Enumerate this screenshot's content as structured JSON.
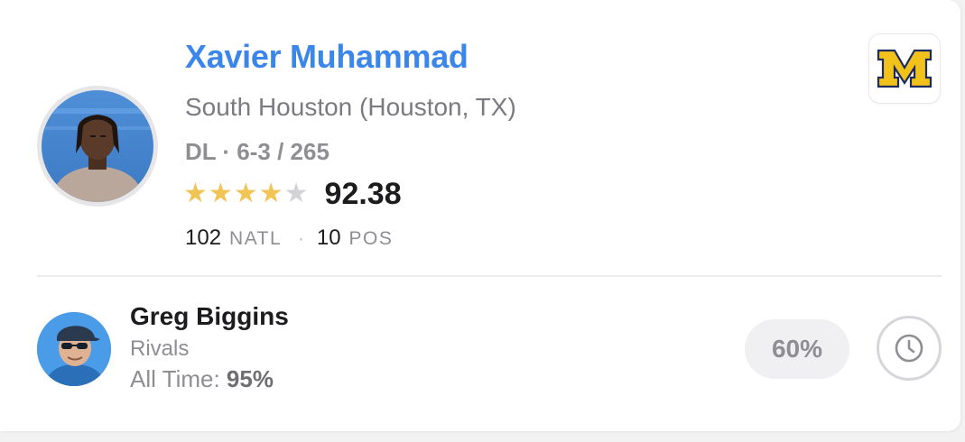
{
  "player": {
    "name": "Xavier Muhammad",
    "school": "South Houston (Houston, TX)",
    "position_size": "DL · 6-3 / 265",
    "stars_filled": 4,
    "stars_total": 5,
    "rating": "92.38",
    "natl_rank": "102",
    "natl_label": "NATL",
    "pos_rank": "10",
    "pos_label": "POS",
    "separator": "·",
    "team_logo_icon": "michigan-block-m-icon"
  },
  "prediction": {
    "analyst_name": "Greg Biggins",
    "analyst_org": "Rivals",
    "all_time_label": "All Time:",
    "all_time_value": "95%",
    "confidence": "60%",
    "action_icon": "clock-icon"
  },
  "colors": {
    "name_blue": "#3a86ea",
    "star_gold": "#f0c555",
    "star_empty": "#d3d3d6",
    "michigan_maize": "#f2c21b",
    "michigan_blue": "#1d2a5c"
  }
}
